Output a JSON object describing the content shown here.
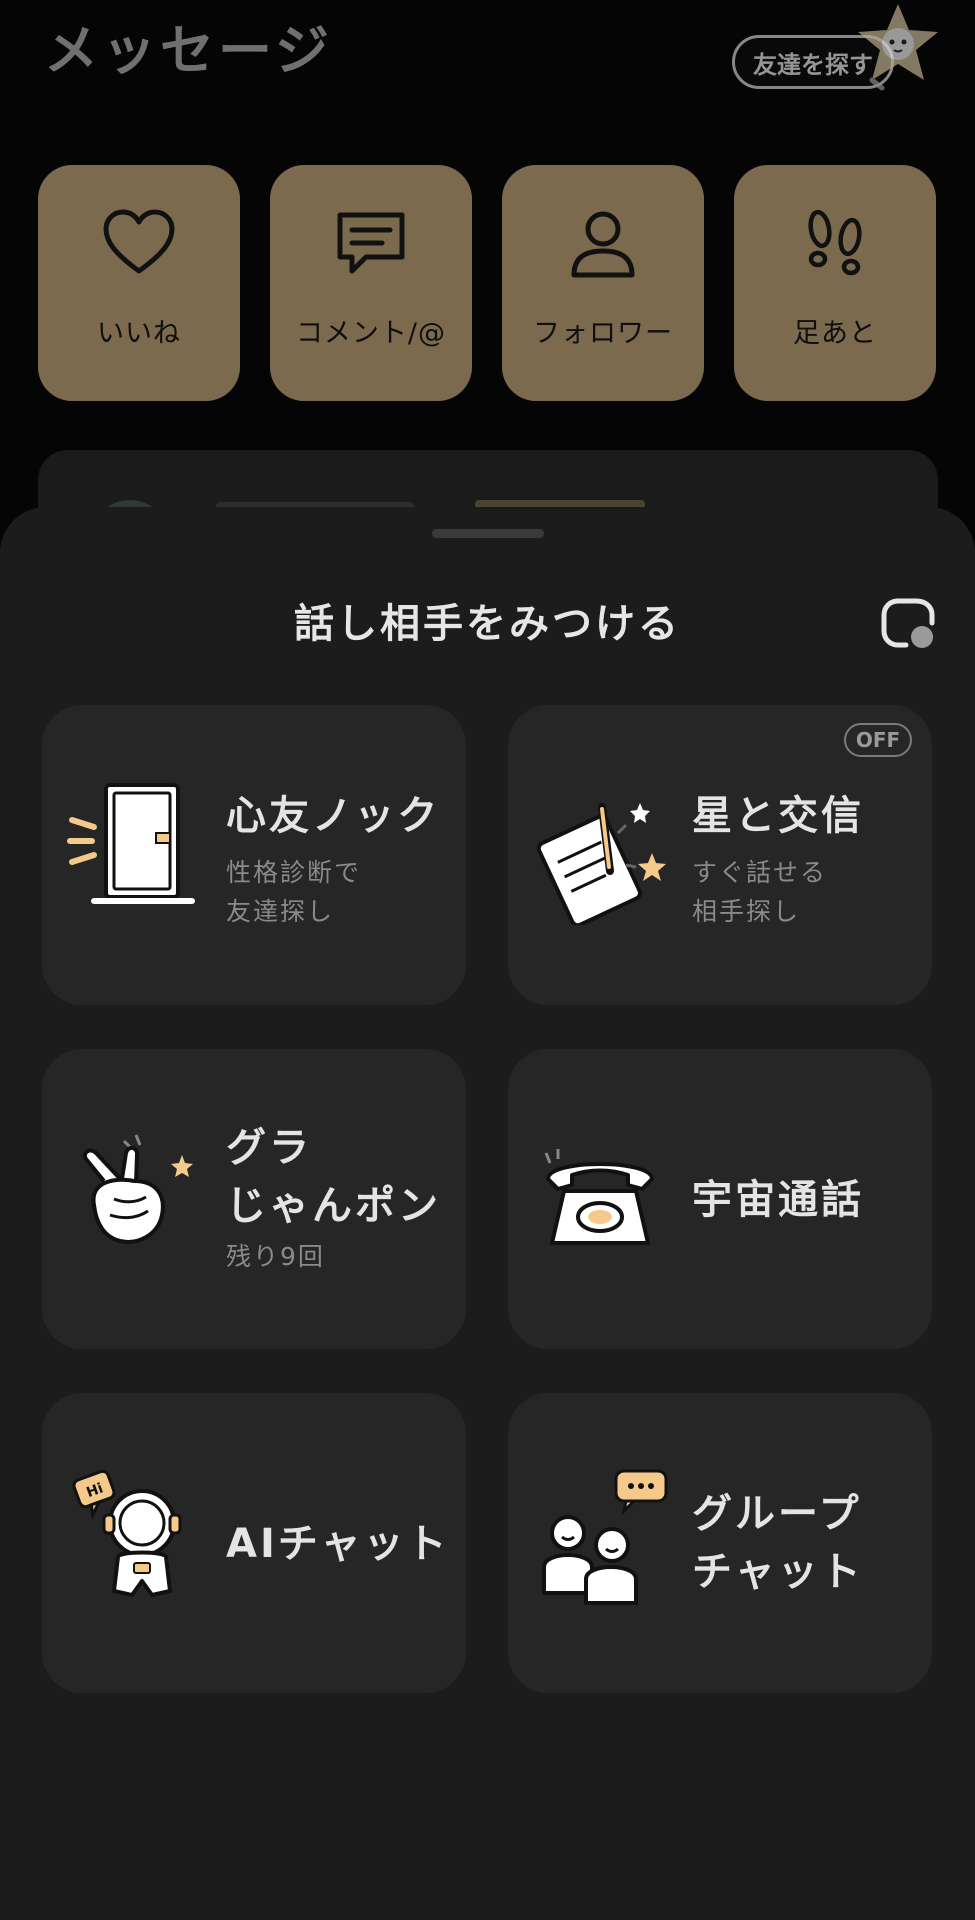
{
  "header": {
    "title": "メッセージ",
    "find_friends_label": "友達を探す"
  },
  "quick_actions": [
    {
      "label": "いいね",
      "icon": "heart-icon"
    },
    {
      "label": "コメント/@",
      "icon": "comment-icon"
    },
    {
      "label": "フォロワー",
      "icon": "person-icon"
    },
    {
      "label": "足あと",
      "icon": "footprints-icon"
    }
  ],
  "sheet": {
    "title": "話し相手をみつける",
    "refresh_icon": "refresh-icon"
  },
  "features": [
    {
      "title": "心友ノック",
      "subtitle1": "性格診断で",
      "subtitle2": "友達探し",
      "icon": "door-icon"
    },
    {
      "title": "星と交信",
      "subtitle1": "すぐ話せる",
      "subtitle2": "相手探し",
      "badge": "OFF",
      "icon": "letter-star-icon"
    },
    {
      "title1": "グラ",
      "title2": "じゃんポン",
      "subtitle1": "残り9回",
      "icon": "peace-hand-icon"
    },
    {
      "title": "宇宙通話",
      "icon": "telephone-icon"
    },
    {
      "title": "AIチャット",
      "icon": "astronaut-icon"
    },
    {
      "title1": "グループ",
      "title2": "チャット",
      "icon": "group-chat-icon"
    }
  ],
  "colors": {
    "quick_card": "#7c6a4e",
    "sheet_bg": "#1c1c1c",
    "feature_card": "#262626",
    "accent_yellow": "#f5c98a"
  }
}
